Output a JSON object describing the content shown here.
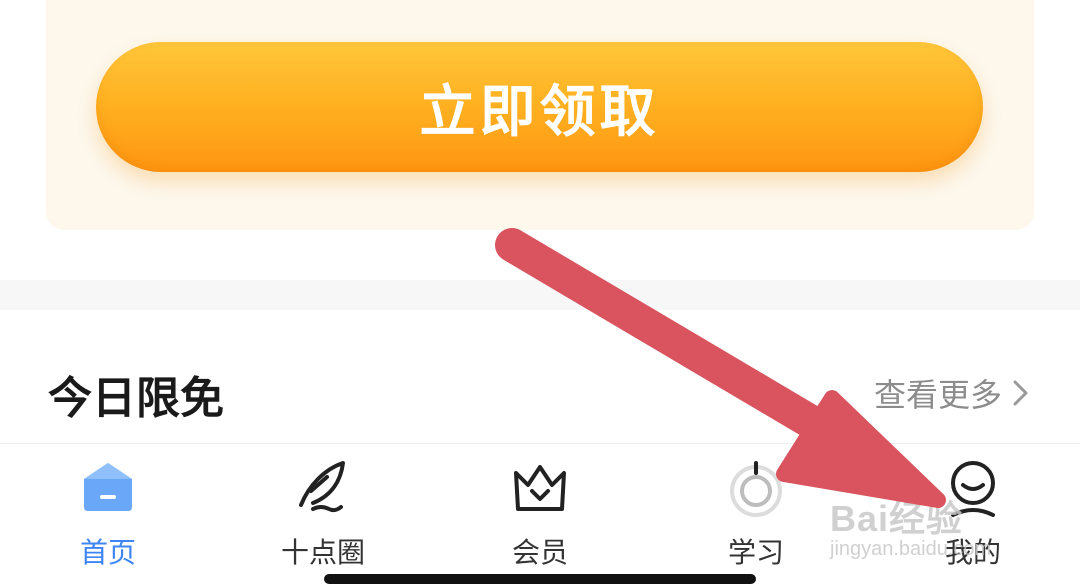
{
  "promo": {
    "claim_button_label": "立即领取"
  },
  "section": {
    "title": "今日限免",
    "see_more_label": "查看更多"
  },
  "tabbar": {
    "items": [
      {
        "label": "首页",
        "icon": "home-icon",
        "active": true
      },
      {
        "label": "十点圈",
        "icon": "feather-icon",
        "active": false
      },
      {
        "label": "会员",
        "icon": "crown-icon",
        "active": false
      },
      {
        "label": "学习",
        "icon": "study-icon",
        "active": false
      },
      {
        "label": "我的",
        "icon": "profile-icon",
        "active": false
      }
    ],
    "active_color": "#3e86f5"
  },
  "annotation": {
    "arrow_color": "#d9545e"
  },
  "watermark": {
    "brand": "Bai经验",
    "site": "jingyan.baidu.com"
  }
}
